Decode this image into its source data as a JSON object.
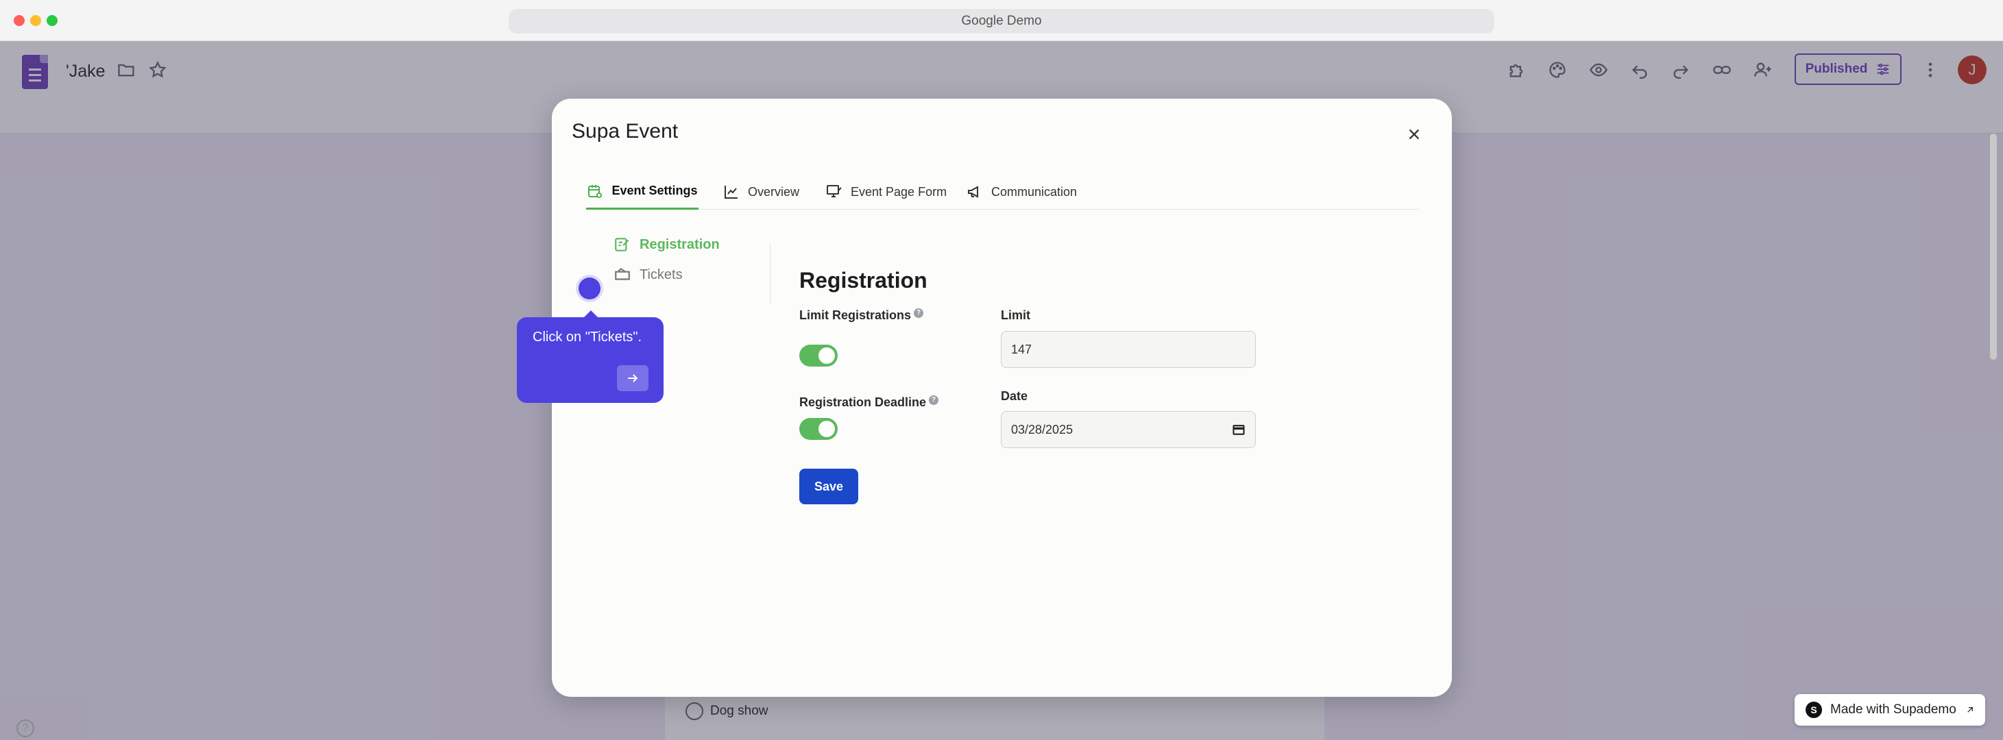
{
  "browser": {
    "url_title": "Google Demo"
  },
  "app": {
    "doc_title": "'Jake",
    "published_label": "Published",
    "avatar_letter": "J",
    "form_option": "Dog show",
    "help_glyph": "?"
  },
  "modal": {
    "title": "Supa Event",
    "tabs": [
      {
        "label": "Event Settings",
        "icon": "calendar-gear-icon",
        "active": true
      },
      {
        "label": "Overview",
        "icon": "line-chart-icon"
      },
      {
        "label": "Event Page Form",
        "icon": "monitor-edit-icon"
      },
      {
        "label": "Communication",
        "icon": "megaphone-icon"
      }
    ],
    "side_nav": [
      {
        "label": "Registration",
        "icon": "edit-note-icon",
        "active": true
      },
      {
        "label": "Tickets",
        "icon": "ticket-icon"
      }
    ],
    "section_title": "Registration",
    "fields": {
      "limit_registrations_label": "Limit Registrations",
      "limit_label": "Limit",
      "limit_value": "147",
      "registration_deadline_label": "Registration Deadline",
      "date_label": "Date",
      "date_value": "03/28/2025"
    },
    "toggles": {
      "limit_registrations": true,
      "registration_deadline": true
    },
    "save_label": "Save"
  },
  "guide": {
    "tooltip_text": "Click on \"Tickets\".",
    "badge": "Made with Supademo",
    "badge_logo": "S"
  },
  "colors": {
    "accent_green": "#5cb85c",
    "primary_blue": "#1a48c9",
    "guide_purple": "#4e41e0",
    "forms_purple": "#673ab7"
  }
}
